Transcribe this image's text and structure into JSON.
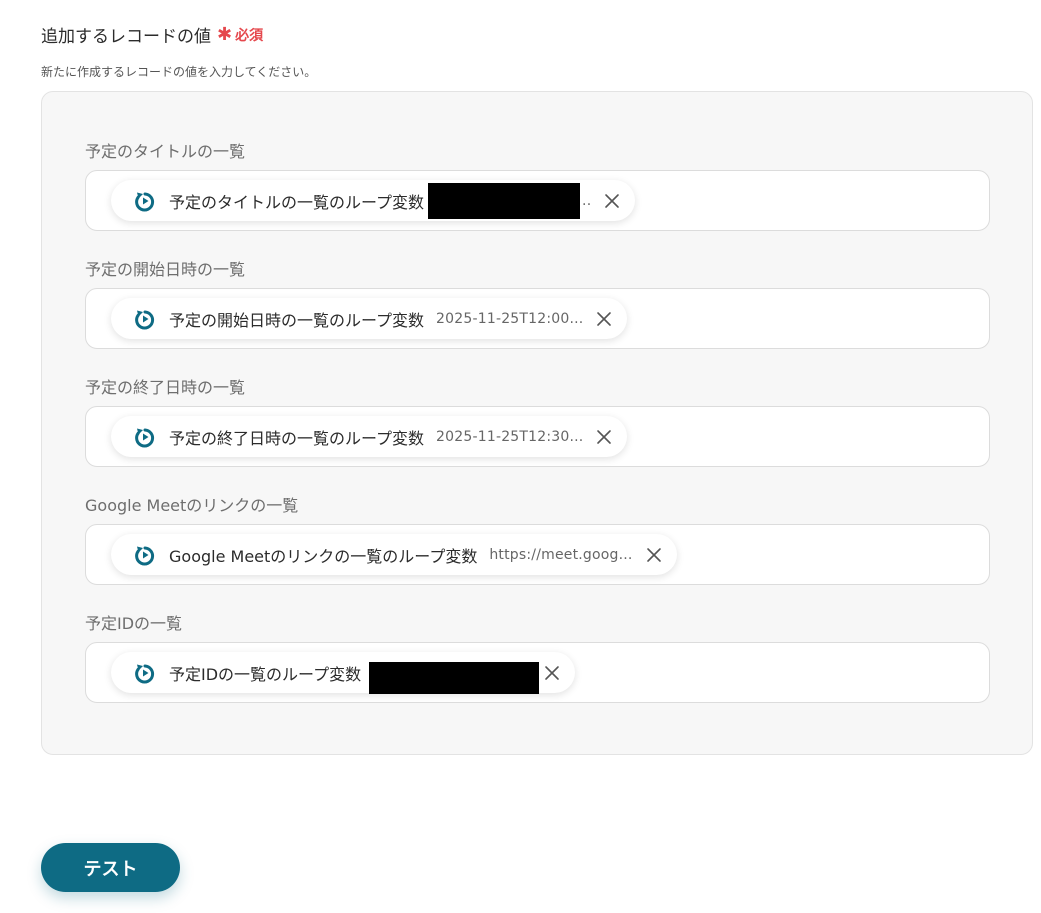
{
  "section": {
    "title": "追加するレコードの値",
    "required_label": "必須",
    "description": "新たに作成するレコードの値を入力してください。"
  },
  "fields": [
    {
      "label": "予定のタイトルの一覧",
      "chip_label": "予定のタイトルの一覧のループ変数",
      "chip_value": "..",
      "redacted": true
    },
    {
      "label": "予定の開始日時の一覧",
      "chip_label": "予定の開始日時の一覧のループ変数",
      "chip_value": "2025-11-25T12:00...",
      "redacted": false
    },
    {
      "label": "予定の終了日時の一覧",
      "chip_label": "予定の終了日時の一覧のループ変数",
      "chip_value": "2025-11-25T12:30...",
      "redacted": false
    },
    {
      "label": "Google Meetのリンクの一覧",
      "chip_label": "Google Meetのリンクの一覧のループ変数",
      "chip_value": "https://meet.goog...",
      "redacted": false
    },
    {
      "label": "予定IDの一覧",
      "chip_label": "予定IDの一覧のループ変数",
      "chip_value": "",
      "redacted": true
    }
  ],
  "test_button": {
    "label": "テスト"
  },
  "colors": {
    "accent": "#0e6b84",
    "required": "#e5484d",
    "loop_icon": "#0e6b84"
  },
  "icons": {
    "chip": "loop-icon",
    "remove": "close-icon"
  }
}
